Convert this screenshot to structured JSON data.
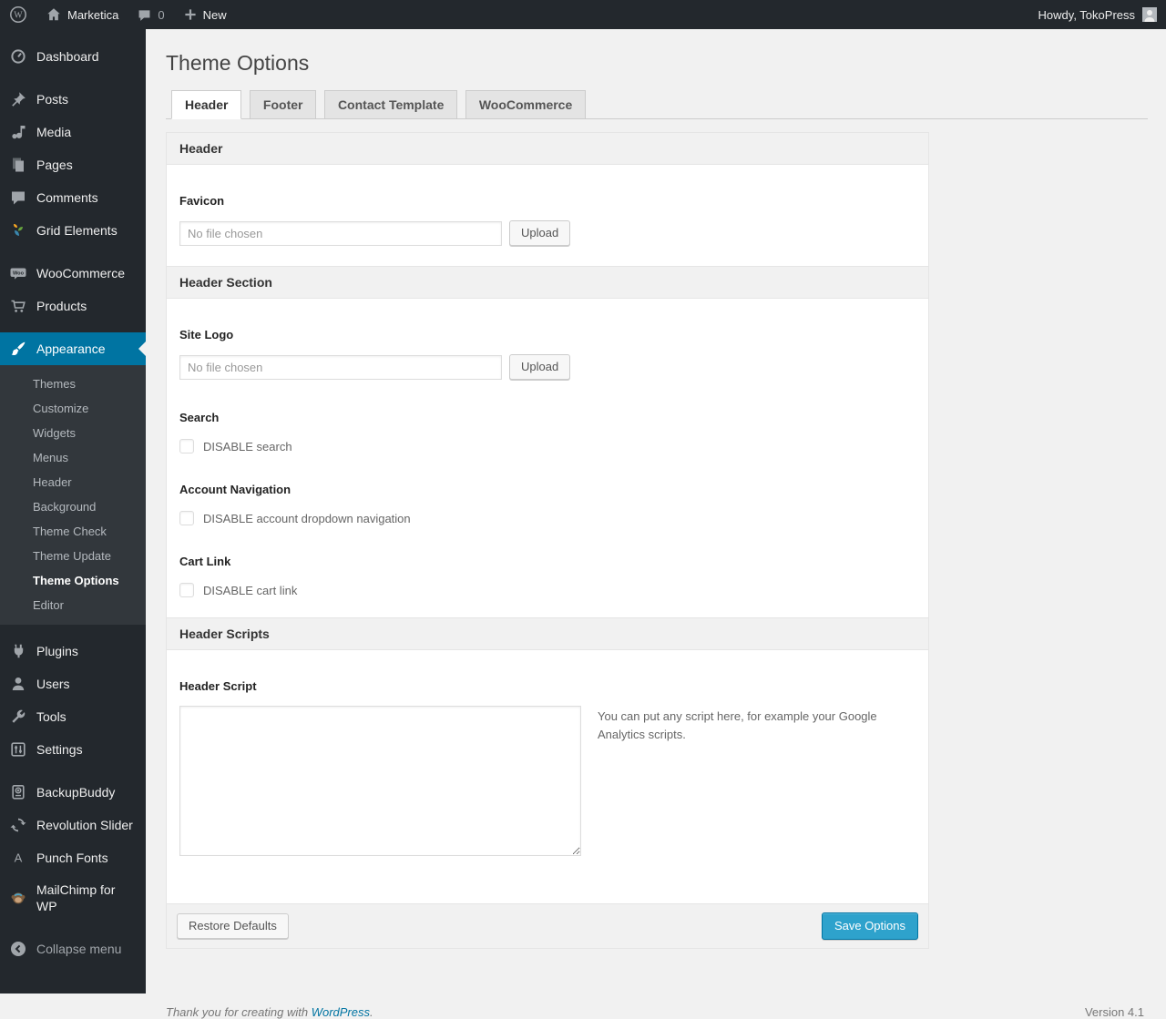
{
  "admin_bar": {
    "site_name": "Marketica",
    "comment_count": "0",
    "new_label": "New",
    "howdy": "Howdy, TokoPress"
  },
  "sidebar": {
    "items": [
      {
        "label": "Dashboard"
      },
      {
        "label": "Posts"
      },
      {
        "label": "Media"
      },
      {
        "label": "Pages"
      },
      {
        "label": "Comments"
      },
      {
        "label": "Grid Elements"
      },
      {
        "label": "WooCommerce"
      },
      {
        "label": "Products"
      },
      {
        "label": "Appearance",
        "active": true
      },
      {
        "label": "Plugins"
      },
      {
        "label": "Users"
      },
      {
        "label": "Tools"
      },
      {
        "label": "Settings"
      },
      {
        "label": "BackupBuddy"
      },
      {
        "label": "Revolution Slider"
      },
      {
        "label": "Punch Fonts"
      },
      {
        "label": "MailChimp for WP"
      }
    ],
    "appearance_submenu": [
      {
        "label": "Themes"
      },
      {
        "label": "Customize"
      },
      {
        "label": "Widgets"
      },
      {
        "label": "Menus"
      },
      {
        "label": "Header"
      },
      {
        "label": "Background"
      },
      {
        "label": "Theme Check"
      },
      {
        "label": "Theme Update"
      },
      {
        "label": "Theme Options",
        "current": true
      },
      {
        "label": "Editor"
      }
    ],
    "collapse_label": "Collapse menu"
  },
  "page": {
    "title": "Theme Options",
    "tabs": [
      {
        "label": "Header",
        "active": true
      },
      {
        "label": "Footer"
      },
      {
        "label": "Contact Template"
      },
      {
        "label": "WooCommerce"
      }
    ],
    "panel": {
      "sections": [
        {
          "title": "Header"
        },
        {
          "title": "Header Section"
        },
        {
          "title": "Header Scripts"
        }
      ],
      "favicon": {
        "label": "Favicon",
        "file_value": "No file chosen",
        "upload": "Upload"
      },
      "site_logo": {
        "label": "Site Logo",
        "file_value": "No file chosen",
        "upload": "Upload"
      },
      "search": {
        "label": "Search",
        "checkbox": "DISABLE search",
        "checked": false
      },
      "account_nav": {
        "label": "Account Navigation",
        "checkbox": "DISABLE account dropdown navigation",
        "checked": false
      },
      "cart_link": {
        "label": "Cart Link",
        "checkbox": "DISABLE cart link",
        "checked": false
      },
      "header_script": {
        "label": "Header Script",
        "textarea_value": "",
        "description": "You can put any script here, for example your Google Analytics scripts."
      },
      "restore_button": "Restore Defaults",
      "save_button": "Save Options"
    }
  },
  "footer": {
    "thanks_prefix": "Thank you for creating with ",
    "thanks_link": "WordPress",
    "thanks_suffix": ".",
    "version": "Version 4.1"
  },
  "colors": {
    "admin_dark": "#23282d",
    "submenu_bg": "#32373c",
    "accent_blue": "#0074a2",
    "button_blue": "#2ea2cc",
    "page_bg": "#f1f1f1"
  }
}
